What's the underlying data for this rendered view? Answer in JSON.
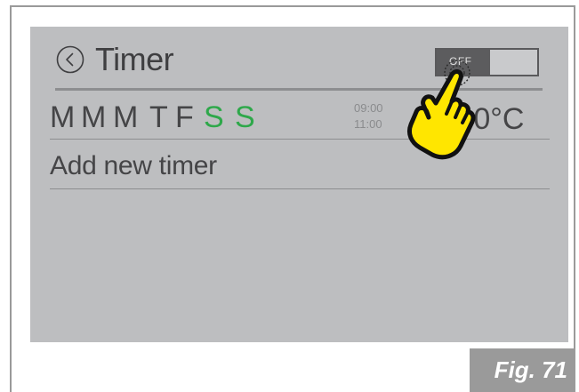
{
  "header": {
    "title": "Timer",
    "back_icon": "chevron-left-circle-icon"
  },
  "toggle": {
    "label": "OFF",
    "state": "off"
  },
  "timer_row": {
    "days": [
      {
        "label": "M",
        "active": false
      },
      {
        "label": "M",
        "active": false
      },
      {
        "label": "M",
        "active": false
      },
      {
        "label": "T",
        "active": false
      },
      {
        "label": "F",
        "active": false
      },
      {
        "label": "S",
        "active": true
      },
      {
        "label": "S",
        "active": true
      }
    ],
    "start_time": "09:00",
    "end_time": "11:00",
    "temperature": "4,0°C"
  },
  "add_timer_label": "Add new timer",
  "figure_label": "Fig. 71",
  "colors": {
    "screen_bg": "#bdbec0",
    "active_day": "#2ea84a",
    "text": "#454547",
    "hand_fill": "#ffe600"
  }
}
